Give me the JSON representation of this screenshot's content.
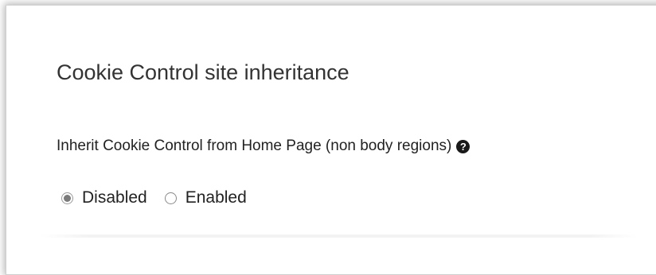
{
  "section": {
    "title": "Cookie Control site inheritance"
  },
  "setting": {
    "label": "Inherit Cookie Control from Home Page (non body regions)",
    "help_icon": "question-circle-icon",
    "help_glyph": "?",
    "options": [
      {
        "label": "Disabled",
        "selected": true
      },
      {
        "label": "Enabled",
        "selected": false
      }
    ]
  },
  "colors": {
    "text": "#222222",
    "radio_selected": "#7a7a7a",
    "border": "#cfcfcf"
  }
}
